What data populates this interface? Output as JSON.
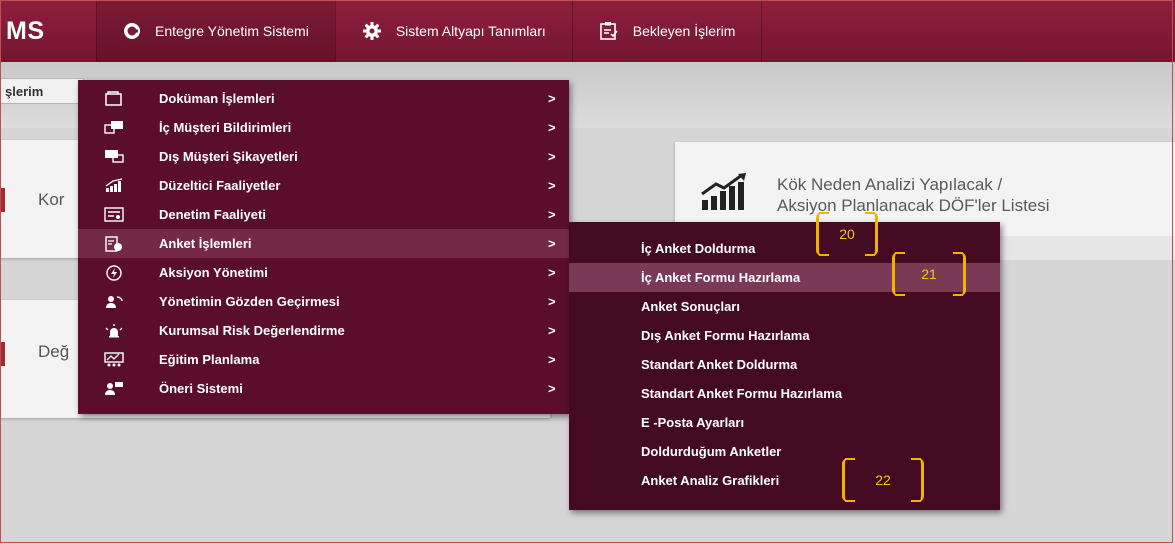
{
  "app": {
    "logo_text": "MS"
  },
  "nav": [
    {
      "label": "Entegre Yönetim Sistemi",
      "icon": "circle-logo-icon"
    },
    {
      "label": "Sistem Altyapı Tanımları",
      "icon": "gear-icon"
    },
    {
      "label": "Bekleyen İşlerim",
      "icon": "clipboard-icon"
    }
  ],
  "breadcrumb": "şlerim",
  "cards": {
    "left_1_text": "Kor",
    "left_2_text": "Değ",
    "right_title_line1": "Kök Neden Analizi Yapılacak /",
    "right_title_line2": "Aksiyon Planlanacak DÖF'ler Listesi"
  },
  "menu": {
    "items": [
      {
        "label": "Doküman İşlemleri",
        "icon": "folder-icon",
        "arrow": ">"
      },
      {
        "label": "İç Müşteri Bildirimleri",
        "icon": "chat-icon",
        "arrow": ">"
      },
      {
        "label": "Dış Müşteri Şikayetleri",
        "icon": "message-icon",
        "arrow": ">"
      },
      {
        "label": "Düzeltici Faaliyetler",
        "icon": "bar-chart-icon",
        "arrow": ">"
      },
      {
        "label": "Denetim Faaliyeti",
        "icon": "audit-icon",
        "arrow": ">"
      },
      {
        "label": "Anket İşlemleri",
        "icon": "survey-icon",
        "arrow": ">"
      },
      {
        "label": "Aksiyon Yönetimi",
        "icon": "lightning-circle-icon",
        "arrow": ">"
      },
      {
        "label": "Yönetimin Gözden Geçirmesi",
        "icon": "review-icon",
        "arrow": ">"
      },
      {
        "label": "Kurumsal Risk Değerlendirme",
        "icon": "alarm-icon",
        "arrow": ">"
      },
      {
        "label": "Eğitim Planlama",
        "icon": "training-icon",
        "arrow": ">"
      },
      {
        "label": "Öneri Sistemi",
        "icon": "user-comment-icon",
        "arrow": ">"
      }
    ],
    "active_index": 5
  },
  "submenu": {
    "items": [
      "İç Anket Doldurma",
      "İç Anket Formu Hazırlama",
      "Anket Sonuçları",
      "Dış Anket Formu Hazırlama",
      "Standart Anket Doldurma",
      "Standart Anket Formu Hazırlama",
      "E -Posta Ayarları",
      "Doldurduğum Anketler",
      "Anket Analiz Grafikleri"
    ],
    "active_index": 1
  },
  "callouts": [
    "20",
    "21",
    "22"
  ],
  "colors": {
    "topbar": "#8e1f3f",
    "menu_bg": "#5a0e2a",
    "submenu_bg": "#440a21",
    "callout": "#f0b400"
  }
}
